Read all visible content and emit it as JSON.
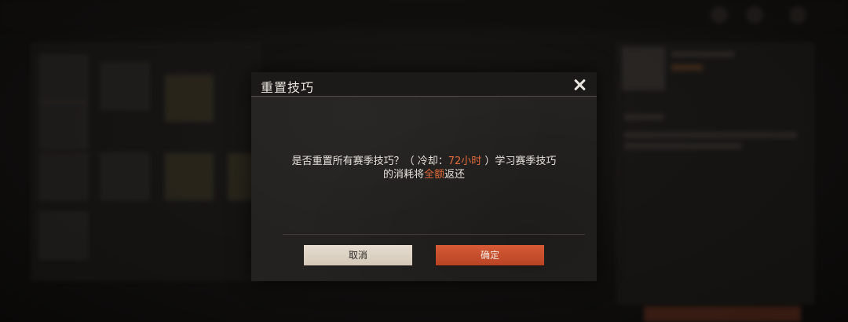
{
  "dialog": {
    "title": "重置技巧",
    "message": {
      "line1_prefix": "是否重置所有赛季技巧？（ 冷却：",
      "cooldown": "72小时",
      "line1_suffix": " ）学习赛季技巧",
      "line2_prefix": "的消耗将",
      "full_amount": "全额",
      "line2_suffix": "返还"
    },
    "cancel_label": "取消",
    "confirm_label": "确定"
  },
  "colors": {
    "highlight": "#e26a3a",
    "confirm_button": "#c94c2b",
    "cancel_button": "#ddd3c4",
    "dialog_background": "#242220"
  },
  "icons": {
    "close": "close-icon"
  }
}
